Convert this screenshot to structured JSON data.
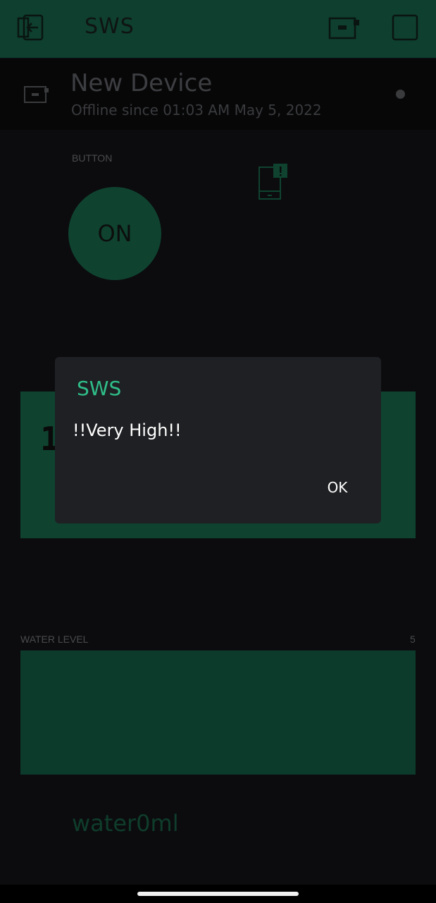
{
  "app": {
    "title": "SWS"
  },
  "device": {
    "name": "New Device",
    "status": "Offline since 01:03 AM May 5, 2022"
  },
  "widgets": {
    "button_label": "BUTTON",
    "button_state": "ON",
    "display_digit": "1",
    "water_level_label": "WATER LEVEL",
    "water_level_value": "5",
    "water_text": "water0ml"
  },
  "dialog": {
    "title": "SWS",
    "message": "!!Very High!!",
    "ok_label": "OK"
  },
  "icons": {
    "back": "exit-icon",
    "device": "device-icon",
    "square": "square-icon",
    "notification": "phone-notification-icon"
  },
  "colors": {
    "accent": "#0e3f2f",
    "dialog_title": "#2fbf8a",
    "dialog_bg": "#1f2023"
  }
}
